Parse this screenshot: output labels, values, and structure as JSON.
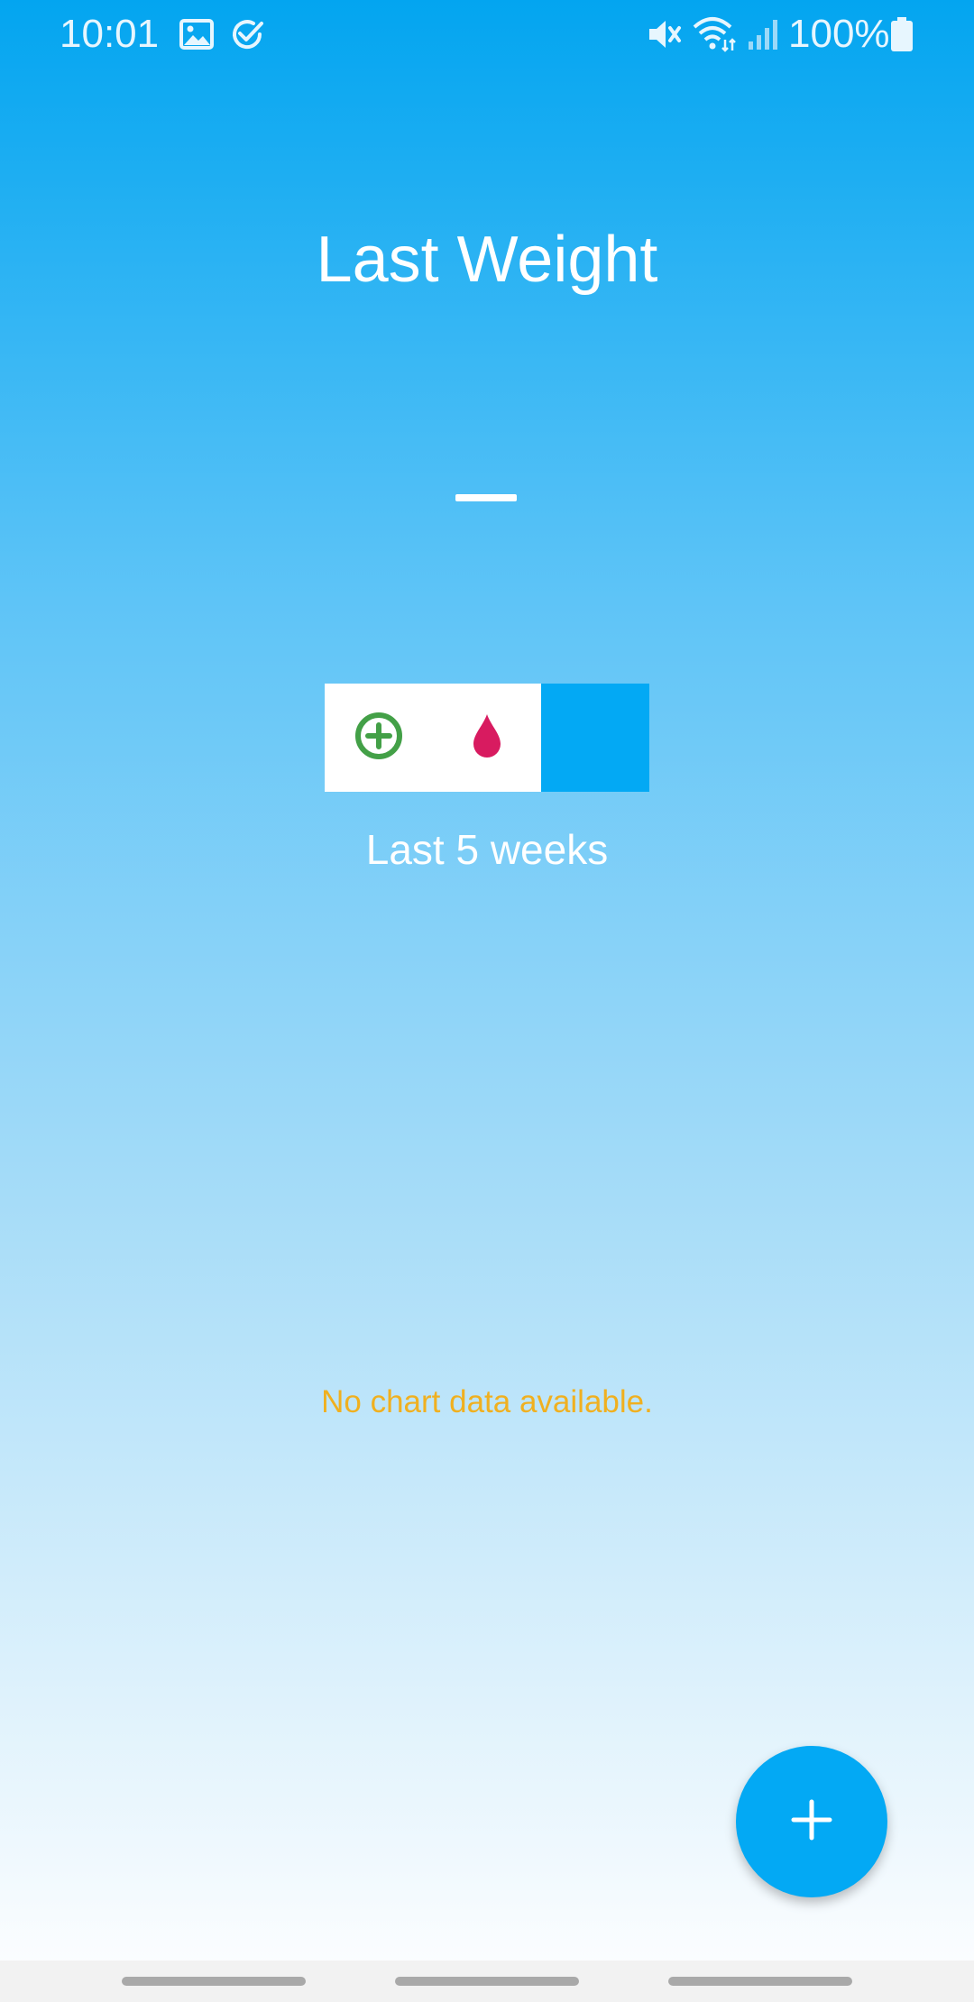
{
  "status_bar": {
    "time": "10:01",
    "battery_percent": "100%",
    "icons": [
      "gallery-icon",
      "check-circle-icon",
      "mute-icon",
      "wifi-icon",
      "signal-icon",
      "battery-icon"
    ]
  },
  "header": {
    "title": "Last Weight",
    "value": ""
  },
  "toggle": {
    "items": [
      {
        "icon": "plus-circle-icon",
        "color": "#43A047"
      },
      {
        "icon": "drop-icon",
        "color": "#D81B60"
      },
      {
        "icon": "selected-segment",
        "color": "#03A9F4"
      }
    ]
  },
  "period": {
    "label": "Last 5 weeks"
  },
  "chart": {
    "empty_message": "No chart data available."
  },
  "fab": {
    "icon": "plus-icon",
    "color": "#03A9F4"
  },
  "colors": {
    "accent": "#03A9F4",
    "gradient_top": "#03A5F0",
    "gradient_bottom": "#FBFDFF",
    "empty_message": "#F0B020"
  }
}
